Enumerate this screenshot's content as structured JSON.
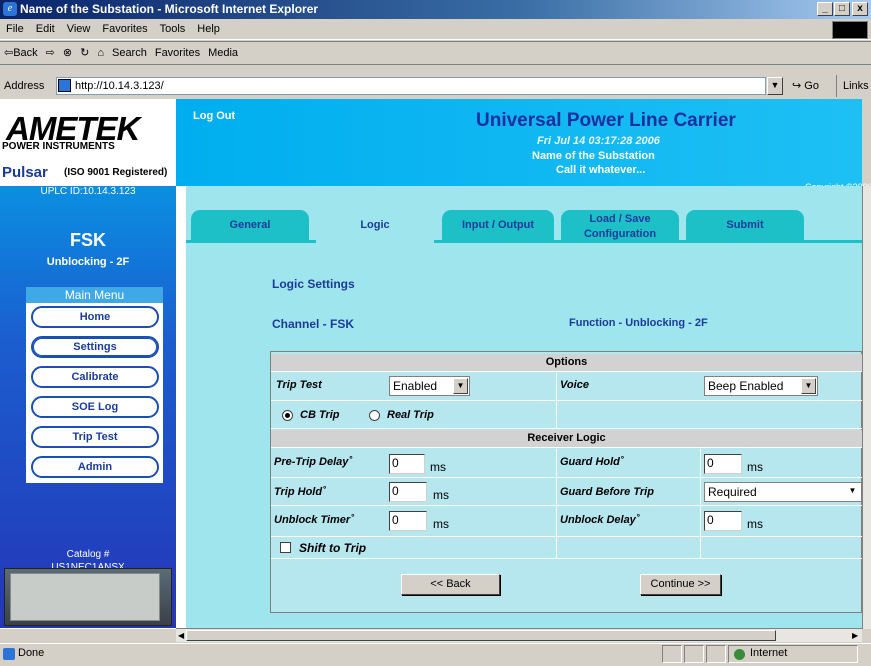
{
  "window": {
    "title": "Name of the Substation - Microsoft Internet Explorer",
    "min": "_",
    "max": "□",
    "close": "x"
  },
  "menu": [
    "File",
    "Edit",
    "View",
    "Favorites",
    "Tools",
    "Help"
  ],
  "toolbar": {
    "back": "⇦Back",
    "forward": "⇨",
    "stop": "⊗",
    "refresh": "↻",
    "home": "⌂",
    "search": "Search",
    "favorites": "Favorites",
    "media": "Media"
  },
  "address": {
    "label": "Address",
    "url": "http://10.14.3.123/",
    "go": "Go",
    "links": "Links"
  },
  "status": {
    "text": "Done",
    "zone": "Internet"
  },
  "brand": {
    "ametek": "AMETEK",
    "power": "POWER INSTRUMENTS",
    "pulsar": "Pulsar",
    "iso": "(ISO 9001 Registered)",
    "uplc_id": "UPLC ID:10.14.3.123"
  },
  "header": {
    "logout": "Log Out",
    "title": "Universal Power Line Carrier",
    "datetime": "Fri Jul 14 03:17:28 2006",
    "station": "Name of the Substation",
    "callit": "Call it whatever...",
    "copyright": "Copyright ©2006"
  },
  "sidebar": {
    "mode": "FSK",
    "scheme": "Unblocking - 2F",
    "menu_title": "Main Menu",
    "items": [
      "Home",
      "Settings",
      "Calibrate",
      "SOE Log",
      "Trip Test",
      "Admin"
    ],
    "catalog_label": "Catalog #",
    "catalog": "US1NEC1ANSX"
  },
  "tabs": [
    {
      "label": "General"
    },
    {
      "label": "Logic"
    },
    {
      "label": "Input / Output"
    },
    {
      "label1": "Load / Save",
      "label2": "Configuration"
    },
    {
      "label": "Submit"
    }
  ],
  "logic": {
    "heading": "Logic Settings",
    "channel": "Channel - FSK",
    "function": "Function - Unblocking - 2F",
    "options_title": "Options",
    "trip_test_label": "Trip Test",
    "trip_test_value": "Enabled",
    "voice_label": "Voice",
    "voice_value": "Beep Enabled",
    "cb_trip": "CB Trip",
    "real_trip": "Real Trip",
    "receiver_title": "Receiver Logic",
    "pre_trip_label": "Pre-Trip Delay˚",
    "pre_trip_value": "0",
    "guard_hold_label": "Guard Hold˚",
    "guard_hold_value": "0",
    "trip_hold_label": "Trip Hold˚",
    "trip_hold_value": "0",
    "guard_before_label": "Guard Before Trip",
    "guard_before_value": "Required",
    "unblock_timer_label": "Unblock Timer˚",
    "unblock_timer_value": "0",
    "unblock_delay_label": "Unblock Delay˚",
    "unblock_delay_value": "0",
    "unit": "ms",
    "shift_to_trip": "Shift to Trip",
    "back": "<< Back",
    "continue": "Continue >>"
  }
}
